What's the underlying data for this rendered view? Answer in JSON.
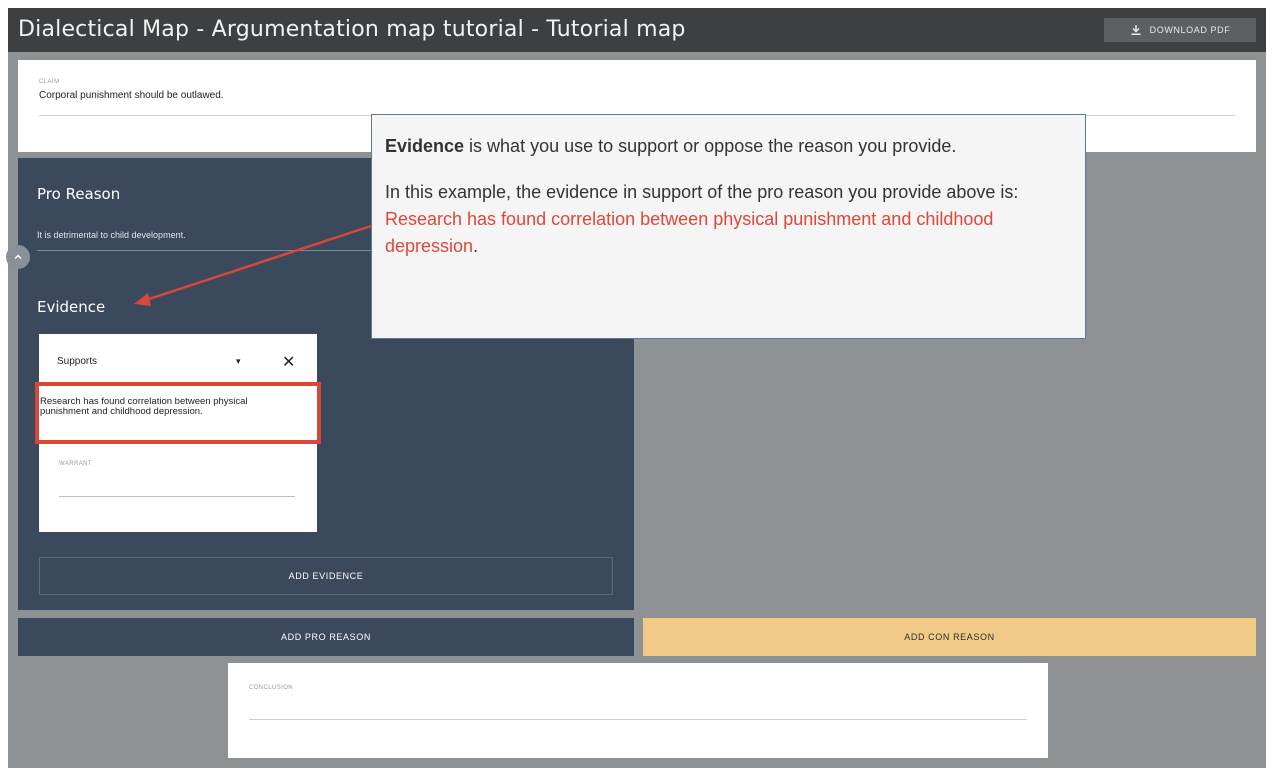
{
  "header": {
    "title": "Dialectical Map - Argumentation map tutorial - Tutorial map",
    "download_label": "DOWNLOAD PDF",
    "download_icon": "download-icon"
  },
  "claim": {
    "label": "CLAIM",
    "text": "Corporal punishment should be outlawed."
  },
  "pro_reason": {
    "title": "Pro Reason",
    "text": "It is detrimental to child development.",
    "collapse_icon": "chevron-up-icon"
  },
  "evidence": {
    "title": "Evidence",
    "type": "Supports",
    "type_caret": "▾",
    "close_symbol": "✕",
    "text": "Research has found correlation between physical punishment and childhood depression.",
    "warrant_label": "WARRANT",
    "add_label": "ADD EVIDENCE"
  },
  "buttons": {
    "add_pro": "ADD PRO REASON",
    "add_con": "ADD CON REASON"
  },
  "conclusion": {
    "label": "CONCLUSION"
  },
  "callout": {
    "term": "Evidence",
    "line1_rest": " is what you use to support or oppose the reason you provide.",
    "line2_prefix": "In this example, the evidence in support of the pro reason you provide above is: ",
    "line2_highlight": "Research has found correlation between physical punishment and childhood depression",
    "line2_suffix": "."
  },
  "colors": {
    "header_bg": "#3d3f41",
    "canvas_bg": "#8e9294",
    "pro_panel_bg": "#3a4a5c",
    "con_button_bg": "#f2ca87",
    "highlight_red": "#d9473a",
    "callout_red": "#e0463a"
  }
}
